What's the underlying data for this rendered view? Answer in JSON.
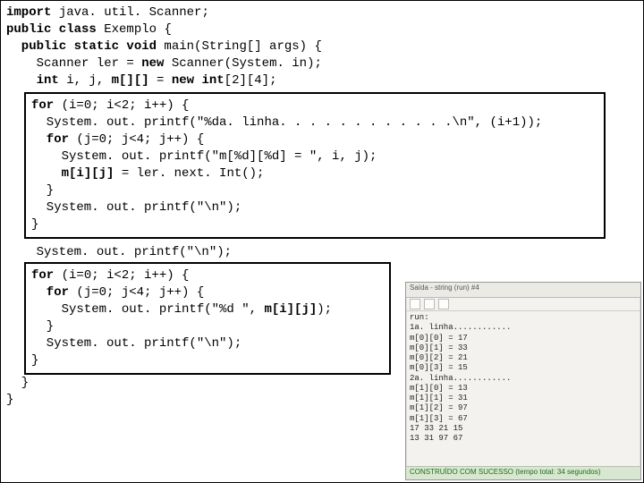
{
  "code": {
    "line1_pre": "import",
    "line1_post": " java. util. Scanner;",
    "line2_pre": "public class",
    "line2_post": " Exemplo {",
    "line3_pre": "  public static void",
    "line3_post": " main(String[] args) {",
    "line4a": "    Scanner ler = ",
    "line4b": "new",
    "line4c": " Scanner(System. in);",
    "line5a": "    int",
    "line5b": " i, j, ",
    "line5c": "m[][]",
    "line5d": " = ",
    "line5e": "new int",
    "line5f": "[2][4];",
    "box1_l1a": "for",
    "box1_l1b": " (i=0; i<2; i++) {",
    "box1_l2": "  System. out. printf(\"%da. linha. . . . . . . . . . . .\\n\", (i+1));",
    "box1_l3a": "  for",
    "box1_l3b": " (j=0; j<4; j++) {",
    "box1_l4": "    System. out. printf(\"m[%d][%d] = \", i, j);",
    "box1_l5a": "    ",
    "box1_l5b": "m[i][j]",
    "box1_l5c": " = ler. next. Int();",
    "box1_l6": "  }",
    "box1_l7": "  System. out. printf(\"\\n\");",
    "box1_l8": "}",
    "between": "    System. out. printf(\"\\n\");",
    "box2_l1a": "for",
    "box2_l1b": " (i=0; i<2; i++) {",
    "box2_l2a": "  for",
    "box2_l2b": " (j=0; j<4; j++) {",
    "box2_l3a": "    System. out. printf(\"%d \", ",
    "box2_l3b": "m[i][j]",
    "box2_l3c": ");",
    "box2_l4": "  }",
    "box2_l5": "  System. out. printf(\"\\n\");",
    "box2_l6": "}",
    "close1": "  }",
    "close2": "}"
  },
  "output": {
    "title": "Saída - string (run) #4",
    "lines": [
      "run:",
      "1a. linha............",
      "m[0][0] = 17",
      "m[0][1] = 33",
      "m[0][2] = 21",
      "m[0][3] = 15",
      "",
      "2a. linha............",
      "m[1][0] = 13",
      "m[1][1] = 31",
      "m[1][2] = 97",
      "m[1][3] = 67",
      "",
      "17 33 21 15",
      "13 31 97 67"
    ],
    "status": "CONSTRUÍDO COM SUCESSO (tempo total: 34 segundos)"
  }
}
